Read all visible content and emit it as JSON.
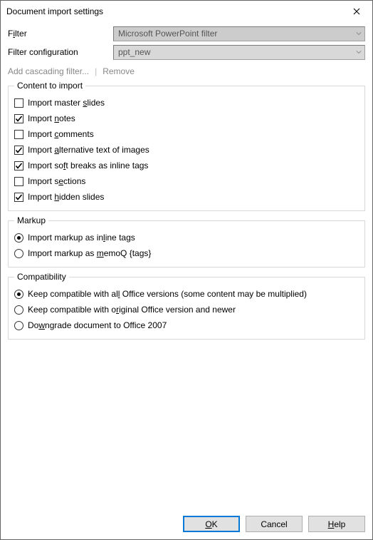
{
  "window": {
    "title": "Document import settings"
  },
  "filter": {
    "label_pre": "F",
    "label_ul": "i",
    "label_post": "lter",
    "value": "Microsoft PowerPoint filter"
  },
  "filter_config": {
    "label": "Filter configuration",
    "value": "ppt_new"
  },
  "linkbar": {
    "add": "Add cascading filter...",
    "remove": "Remove"
  },
  "groups": {
    "content": {
      "legend": "Content to import",
      "items": [
        {
          "id": "master-slides",
          "pre": "Import master ",
          "ul": "s",
          "post": "lides",
          "checked": false
        },
        {
          "id": "notes",
          "pre": "Import ",
          "ul": "n",
          "post": "otes",
          "checked": true
        },
        {
          "id": "comments",
          "pre": "Import ",
          "ul": "c",
          "post": "omments",
          "checked": false
        },
        {
          "id": "alt-text",
          "pre": "Import ",
          "ul": "a",
          "post": "lternative text of images",
          "checked": true
        },
        {
          "id": "soft-breaks",
          "pre": "Import so",
          "ul": "f",
          "post": "t breaks as inline tags",
          "checked": true
        },
        {
          "id": "sections",
          "pre": "Import s",
          "ul": "e",
          "post": "ctions",
          "checked": false
        },
        {
          "id": "hidden-slides",
          "pre": "Import ",
          "ul": "h",
          "post": "idden slides",
          "checked": true
        }
      ]
    },
    "markup": {
      "legend": "Markup",
      "items": [
        {
          "id": "markup-inline",
          "pre": "Import markup as in",
          "ul": "l",
          "post": "ine tags",
          "checked": true
        },
        {
          "id": "markup-memoq",
          "pre": "Import markup as ",
          "ul": "m",
          "post": "emoQ {tags}",
          "checked": false
        }
      ]
    },
    "compat": {
      "legend": "Compatibility",
      "items": [
        {
          "id": "compat-all",
          "pre": "Keep compatible with al",
          "ul": "l",
          "post": " Office versions (some content may be multiplied)",
          "checked": true
        },
        {
          "id": "compat-orig",
          "pre": "Keep compatible with o",
          "ul": "r",
          "post": "iginal Office version and newer",
          "checked": false
        },
        {
          "id": "compat-2007",
          "pre": "Do",
          "ul": "w",
          "post": "ngrade document to Office 2007",
          "checked": false
        }
      ]
    }
  },
  "buttons": {
    "ok_ul": "O",
    "ok_post": "K",
    "cancel": "Cancel",
    "help_ul": "H",
    "help_post": "elp"
  }
}
